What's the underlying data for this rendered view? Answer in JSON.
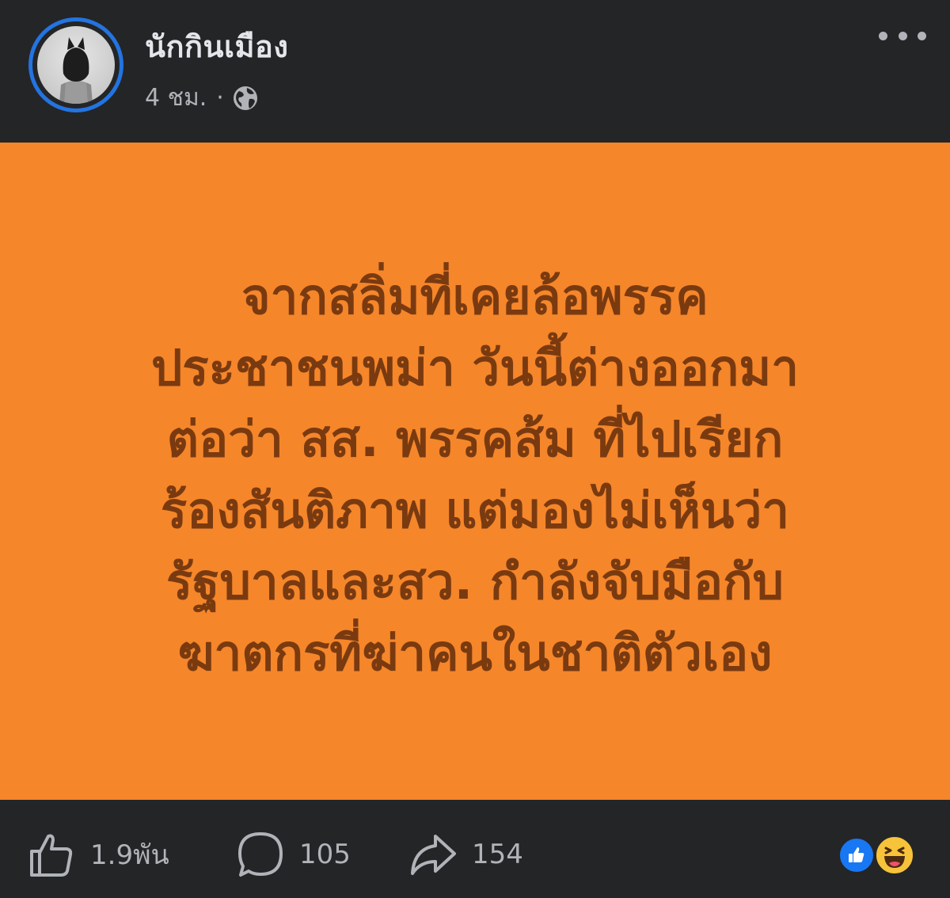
{
  "post": {
    "author": "นักกินเมือง",
    "time": "4 ชม.",
    "separator": "·",
    "privacy_icon": "globe-icon",
    "more_icon": "more-horizontal-icon"
  },
  "content": {
    "background_color": "#f5862a",
    "text_color": "#7a3a10",
    "lines": [
      "จากสลิ่มที่เคยล้อพรรค",
      "ประชาชนพม่า วันนี้ต่างออกมา",
      "ต่อว่า สส. พรรคส้ม ที่ไปเรียก",
      "ร้องสันติภาพ แต่มองไม่เห็นว่า",
      "รัฐบาลและสว. กำลังจับมือกับ",
      "ฆาตกรที่ฆ่าคนในชาติตัวเอง"
    ]
  },
  "footer": {
    "likes": "1.9พัน",
    "comments": "105",
    "shares": "154",
    "reactions": [
      "like-reaction-icon",
      "haha-reaction-icon"
    ]
  },
  "colors": {
    "background": "#242526",
    "avatar_ring": "#2374e1",
    "secondary_text": "#b0b3b8",
    "like_blue": "#1877f2",
    "haha_yellow": "#f7c33a"
  }
}
